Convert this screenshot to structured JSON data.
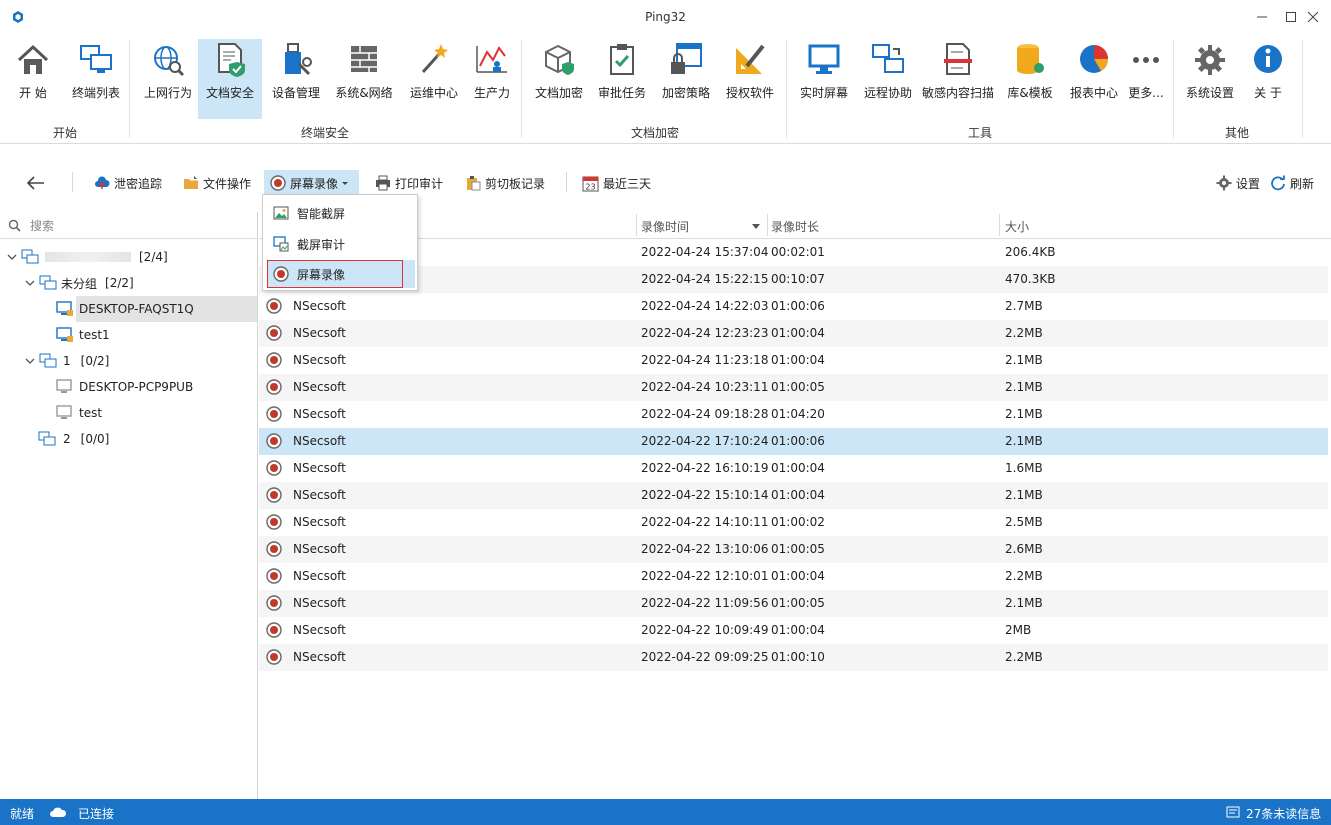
{
  "window": {
    "title": "Ping32"
  },
  "ribbon": {
    "items": [
      {
        "label": "开 始"
      },
      {
        "label": "终端列表"
      },
      {
        "label": "上网行为"
      },
      {
        "label": "文档安全"
      },
      {
        "label": "设备管理"
      },
      {
        "label": "系统&网络"
      },
      {
        "label": "运维中心"
      },
      {
        "label": "生产力"
      },
      {
        "label": "文档加密"
      },
      {
        "label": "审批任务"
      },
      {
        "label": "加密策略"
      },
      {
        "label": "授权软件"
      },
      {
        "label": "实时屏幕"
      },
      {
        "label": "远程协助"
      },
      {
        "label": "敏感内容扫描"
      },
      {
        "label": "库&模板"
      },
      {
        "label": "报表中心"
      },
      {
        "label": "更多..."
      },
      {
        "label": "系统设置"
      },
      {
        "label": "关 于"
      }
    ],
    "groups": [
      {
        "label": "开始"
      },
      {
        "label": "终端安全"
      },
      {
        "label": "文档加密"
      },
      {
        "label": "工具"
      },
      {
        "label": "其他"
      }
    ]
  },
  "toolbar": {
    "leak_trace": "泄密追踪",
    "file_ops": "文件操作",
    "screen_record": "屏幕录像",
    "print_audit": "打印审计",
    "clipboard": "剪切板记录",
    "date_range": "最近三天",
    "calendar_day": "23",
    "settings": "设置",
    "refresh": "刷新"
  },
  "dropdown": {
    "items": [
      {
        "label": "智能截屏"
      },
      {
        "label": "截屏审计"
      },
      {
        "label": "屏幕录像"
      }
    ]
  },
  "search": {
    "placeholder": "搜索"
  },
  "tree": {
    "root_count": "[2/4]",
    "nodes": [
      {
        "label": "未分组",
        "count": "[2/2]"
      },
      {
        "label": "DESKTOP-FAQST1Q"
      },
      {
        "label": "test1"
      },
      {
        "label": "1",
        "count": "[0/2]"
      },
      {
        "label": "DESKTOP-PCP9PUB"
      },
      {
        "label": "test"
      },
      {
        "label": "2",
        "count": "[0/0]"
      }
    ]
  },
  "grid": {
    "columns": {
      "time": "录像时间",
      "duration": "录像时长",
      "size": "大小"
    },
    "rows": [
      {
        "name": "",
        "time": "2022-04-24 15:37:04",
        "duration": "00:02:01",
        "size": "206.4KB"
      },
      {
        "name": "",
        "time": "2022-04-24 15:22:15",
        "duration": "00:10:07",
        "size": "470.3KB"
      },
      {
        "name": "NSecsoft",
        "time": "2022-04-24 14:22:03",
        "duration": "01:00:06",
        "size": "2.7MB"
      },
      {
        "name": "NSecsoft",
        "time": "2022-04-24 12:23:23",
        "duration": "01:00:04",
        "size": "2.2MB"
      },
      {
        "name": "NSecsoft",
        "time": "2022-04-24 11:23:18",
        "duration": "01:00:04",
        "size": "2.1MB"
      },
      {
        "name": "NSecsoft",
        "time": "2022-04-24 10:23:11",
        "duration": "01:00:05",
        "size": "2.1MB"
      },
      {
        "name": "NSecsoft",
        "time": "2022-04-24 09:18:28",
        "duration": "01:04:20",
        "size": "2.1MB"
      },
      {
        "name": "NSecsoft",
        "time": "2022-04-22 17:10:24",
        "duration": "01:00:06",
        "size": "2.1MB"
      },
      {
        "name": "NSecsoft",
        "time": "2022-04-22 16:10:19",
        "duration": "01:00:04",
        "size": "1.6MB"
      },
      {
        "name": "NSecsoft",
        "time": "2022-04-22 15:10:14",
        "duration": "01:00:04",
        "size": "2.1MB"
      },
      {
        "name": "NSecsoft",
        "time": "2022-04-22 14:10:11",
        "duration": "01:00:02",
        "size": "2.5MB"
      },
      {
        "name": "NSecsoft",
        "time": "2022-04-22 13:10:06",
        "duration": "01:00:05",
        "size": "2.6MB"
      },
      {
        "name": "NSecsoft",
        "time": "2022-04-22 12:10:01",
        "duration": "01:00:04",
        "size": "2.2MB"
      },
      {
        "name": "NSecsoft",
        "time": "2022-04-22 11:09:56",
        "duration": "01:00:05",
        "size": "2.1MB"
      },
      {
        "name": "NSecsoft",
        "time": "2022-04-22 10:09:49",
        "duration": "01:00:04",
        "size": "2MB"
      },
      {
        "name": "NSecsoft",
        "time": "2022-04-22 09:09:25",
        "duration": "01:00:10",
        "size": "2.2MB"
      }
    ]
  },
  "status": {
    "ready": "就绪",
    "connected": "已连接",
    "unread": "27条未读信息"
  },
  "colors": {
    "accent": "#1a73c6",
    "selection": "#cde6f7",
    "record_red": "#c0392b"
  }
}
